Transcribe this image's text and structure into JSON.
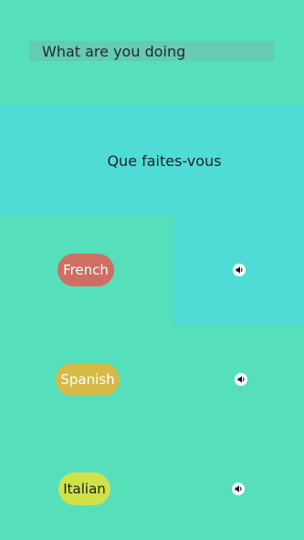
{
  "input": {
    "text": "What are you doing"
  },
  "translation": {
    "text": "Que faites-vous"
  },
  "languages": [
    {
      "label": "French",
      "color": "#CF6E63",
      "icon": "speaker-icon"
    },
    {
      "label": "Spanish",
      "color": "#D7BA45",
      "icon": "speaker-icon"
    },
    {
      "label": "Italian",
      "color": "#CFE24A",
      "icon": "speaker-icon"
    }
  ],
  "colors": {
    "background": "#56DFBB",
    "highlight": "#4FDCD7",
    "input_bar": "#7FB7AE"
  }
}
